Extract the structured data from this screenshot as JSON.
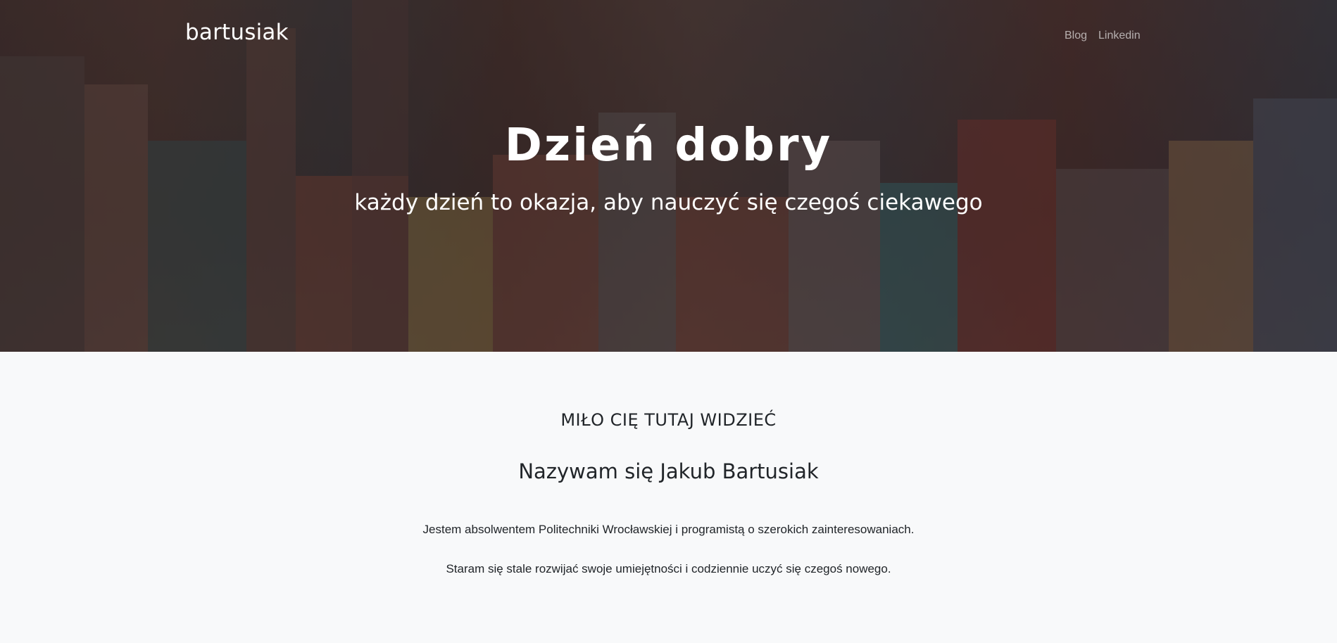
{
  "navbar": {
    "brand": "bartusiak",
    "links": [
      {
        "label": "Blog"
      },
      {
        "label": "Linkedin"
      }
    ]
  },
  "hero": {
    "title": "Dzień dobry",
    "subtitle": "każdy dzień to okazja, aby nauczyć się czegoś ciekawego"
  },
  "about": {
    "kicker": "MIŁO CIĘ TUTAJ WIDZIEĆ",
    "name_line": "Nazywam się Jakub Bartusiak",
    "paragraphs": [
      "Jestem absolwentem Politechniki Wrocławskiej i programistą o szerokich zainteresowaniach.",
      "Staram się stale rozwijać swoje umiejętności i codziennie uczyć się czegoś nowego."
    ]
  },
  "colors": {
    "text_dark": "#212529",
    "page_bg": "#f8f9fa",
    "hero_text": "#ffffff"
  }
}
